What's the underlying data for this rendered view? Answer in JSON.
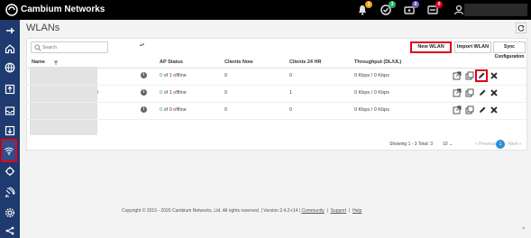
{
  "header": {
    "brand": "Cambium Networks",
    "badges": [
      {
        "icon": "bell-icon",
        "count": "1",
        "color": "#f0a020"
      },
      {
        "icon": "check-circle-icon",
        "count": "3",
        "color": "#27ae60"
      },
      {
        "icon": "devices-icon",
        "count": "0",
        "color": "#7e57c2"
      },
      {
        "icon": "alert-icon",
        "count": "0",
        "color": "#e0001b"
      }
    ]
  },
  "sidebar": {
    "items": [
      "pin-icon",
      "home-icon",
      "globe-icon",
      "upload-box-icon",
      "inbox-icon",
      "download-box-icon",
      "wifi-icon",
      "network-icon",
      "satellite-icon",
      "gear-icon",
      "share-icon"
    ]
  },
  "page": {
    "title": "WLANs",
    "search_placeholder": "Search",
    "buttons": {
      "new": "New WLAN",
      "import": "Import WLAN",
      "sync": "Sync Configuration"
    }
  },
  "table": {
    "columns": [
      "Name",
      "AP Status",
      "Clients Now",
      "Clients 24 HR",
      "Throughput (DL/UL)"
    ],
    "rows": [
      {
        "ap_count": "0",
        "ap_status": " of 1 offline",
        "clients_now": "0",
        "clients_24": "0",
        "throughput": "0 Kbps / 0 Kbps",
        "suffix": ""
      },
      {
        "ap_count": "0",
        "ap_status": " of 1 offline",
        "clients_now": "0",
        "clients_24": "1",
        "throughput": "0 Kbps / 0 Kbps",
        "suffix": "i"
      },
      {
        "ap_count": "0",
        "ap_status": " of 0 offline",
        "clients_now": "0",
        "clients_24": "0",
        "throughput": "0 Kbps / 0 Kbps",
        "suffix": ""
      }
    ]
  },
  "pagination": {
    "showing": "Showing 1 - 3 Total: 3",
    "page_size": "10",
    "prev": "« Previous",
    "current": "1",
    "next": "Next »"
  },
  "footer": {
    "copyright": "Copyright © 2015 - 2020 Cambium Networks, Ltd. All rights reserved.  |  Version 2.4.2-r14  |",
    "community": "Community",
    "support": "Support",
    "help": "Help"
  }
}
